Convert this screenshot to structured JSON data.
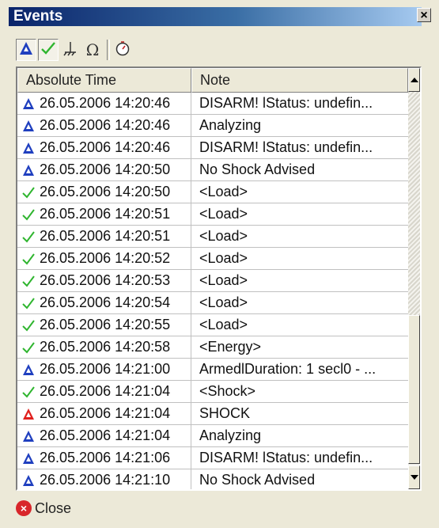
{
  "window": {
    "title": "Events",
    "close_glyph": "×"
  },
  "toolbar": {
    "buttons": [
      {
        "name": "filter-analysis-button",
        "icon": "triangle-a-icon",
        "pressed": true
      },
      {
        "name": "filter-check-button",
        "icon": "checkmark-icon",
        "pressed": true
      },
      {
        "name": "filter-ground-button",
        "icon": "ground-symbol-icon",
        "pressed": false
      },
      {
        "name": "filter-omega-button",
        "icon": "omega-icon",
        "pressed": false
      },
      {
        "name": "timer-button",
        "icon": "stopwatch-icon",
        "pressed": false
      }
    ]
  },
  "table": {
    "headers": [
      "Absolute Time",
      "Note"
    ],
    "rows": [
      {
        "icon": "blue-a",
        "time": "26.05.2006 14:20:46",
        "note": "DISARM! lStatus: undefin..."
      },
      {
        "icon": "blue-a",
        "time": "26.05.2006 14:20:46",
        "note": "Analyzing"
      },
      {
        "icon": "blue-a",
        "time": "26.05.2006 14:20:46",
        "note": "DISARM! lStatus: undefin..."
      },
      {
        "icon": "blue-a",
        "time": "26.05.2006 14:20:50",
        "note": "No Shock Advised"
      },
      {
        "icon": "check",
        "time": "26.05.2006 14:20:50",
        "note": "<Load>"
      },
      {
        "icon": "check",
        "time": "26.05.2006 14:20:51",
        "note": "<Load>"
      },
      {
        "icon": "check",
        "time": "26.05.2006 14:20:51",
        "note": "<Load>"
      },
      {
        "icon": "check",
        "time": "26.05.2006 14:20:52",
        "note": "<Load>"
      },
      {
        "icon": "check",
        "time": "26.05.2006 14:20:53",
        "note": "<Load>"
      },
      {
        "icon": "check",
        "time": "26.05.2006 14:20:54",
        "note": "<Load>"
      },
      {
        "icon": "check",
        "time": "26.05.2006 14:20:55",
        "note": "<Load>"
      },
      {
        "icon": "check",
        "time": "26.05.2006 14:20:58",
        "note": "<Energy>"
      },
      {
        "icon": "blue-a",
        "time": "26.05.2006 14:21:00",
        "note": "ArmedlDuration: 1 secl0 - ..."
      },
      {
        "icon": "check",
        "time": "26.05.2006 14:21:04",
        "note": "<Shock>"
      },
      {
        "icon": "red-a",
        "time": "26.05.2006 14:21:04",
        "note": "SHOCK"
      },
      {
        "icon": "blue-a",
        "time": "26.05.2006 14:21:04",
        "note": "Analyzing"
      },
      {
        "icon": "blue-a",
        "time": "26.05.2006 14:21:06",
        "note": "DISARM! lStatus: undefin..."
      },
      {
        "icon": "blue-a",
        "time": "26.05.2006 14:21:10",
        "note": "No Shock Advised"
      }
    ]
  },
  "footer": {
    "close_label": "Close"
  },
  "colors": {
    "blue": "#1f3fbf",
    "red": "#e0201e",
    "green": "#2fb52f"
  }
}
